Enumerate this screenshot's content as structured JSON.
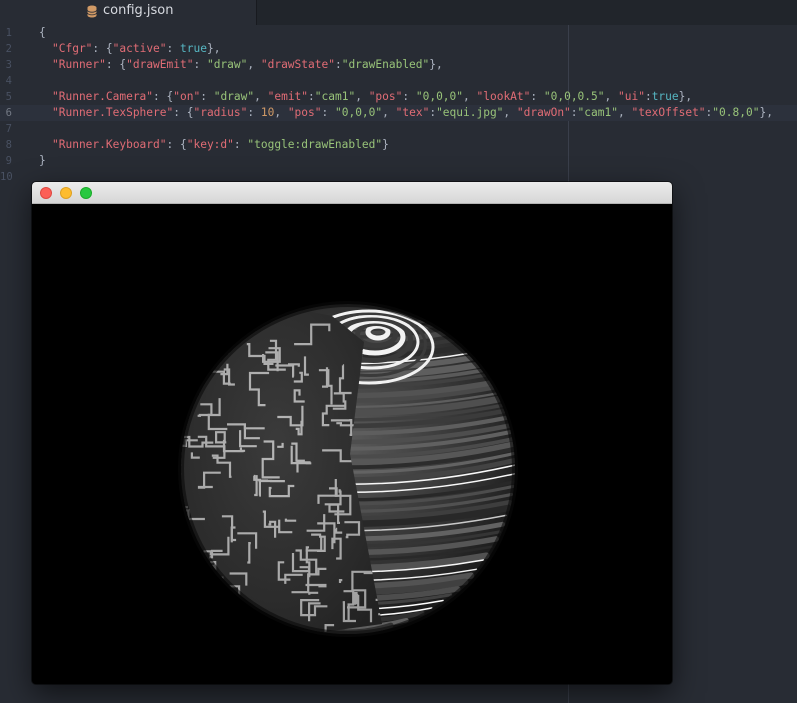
{
  "tab": {
    "label": "config.json",
    "icon": "database-icon"
  },
  "gutter": [
    "1",
    "2",
    "3",
    "4",
    "5",
    "6",
    "7",
    "8",
    "9",
    "10"
  ],
  "code": {
    "line1": "{",
    "line2": {
      "key": "\"Cfgr\"",
      "sep": ": {",
      "k1": "\"active\"",
      "colon1": ": ",
      "v1": "true",
      "end": "},"
    },
    "line3": {
      "key": "\"Runner\"",
      "sep": ": {",
      "k1": "\"drawEmit\"",
      "colon1": ": ",
      "v1": "\"draw\"",
      "comma1": ", ",
      "k2": "\"drawState\"",
      "colon2": ":",
      "v2": "\"drawEnabled\"",
      "end": "},"
    },
    "line5": {
      "key": "\"Runner.Camera\"",
      "sep": ": {",
      "k1": "\"on\"",
      "v1": "\"draw\"",
      "k2": "\"emit\"",
      "v2": "\"cam1\"",
      "k3": "\"pos\"",
      "v3": "\"0,0,0\"",
      "k4": "\"lookAt\"",
      "v4": "\"0,0,0.5\"",
      "k5": "\"ui\"",
      "v5": "true",
      "end": "},"
    },
    "line6": {
      "key": "\"Runner.TexSphere\"",
      "sep": ": {",
      "k1": "\"radius\"",
      "v1": "10",
      "k2": "\"pos\"",
      "v2": "\"0,0,0\"",
      "k3": "\"tex\"",
      "v3": "\"equi.jpg\"",
      "k4": "\"drawOn\"",
      "v4": "\"cam1\"",
      "k5": "\"texOffset\"",
      "v5": "\"0.8,0\"",
      "end": "},"
    },
    "line8": {
      "key": "\"Runner.Keyboard\"",
      "sep": ": {",
      "k1": "\"key:d\"",
      "colon1": ": ",
      "v1": "\"toggle:drawEnabled\"",
      "end": "}"
    },
    "line9": "}"
  },
  "window": {
    "buttons": [
      "close",
      "minimize",
      "maximize"
    ],
    "scene": "textured-sphere"
  },
  "colors": {
    "editor_bg": "#282c34",
    "key": "#e06c75",
    "string": "#98c379",
    "number": "#d19a66",
    "boolean": "#56b6c2",
    "punctuation": "#abb2bf"
  }
}
